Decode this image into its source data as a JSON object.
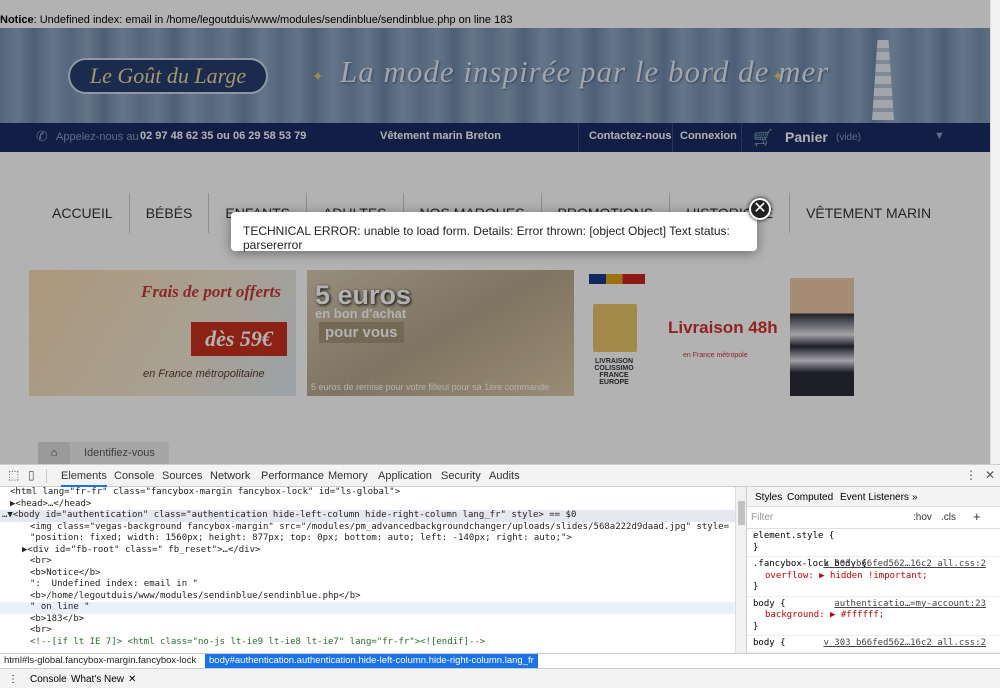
{
  "notice": {
    "label": "Notice",
    "text": ": Undefined index: email in /home/legoutduis/www/modules/sendinblue/sendinblue.php on line 183"
  },
  "header": {
    "logo": "Le Goût du Large",
    "tagline": "La mode inspirée par le bord de mer"
  },
  "topbar": {
    "call_label": "Appelez-nous au :",
    "phone": "02 97 48 62 35 ou 06 29 58 53 79",
    "middle": "Vêtement marin Breton",
    "contact": "Contactez-nous",
    "login": "Connexion",
    "cart": "Panier",
    "cart_state": "(vide)"
  },
  "menu": {
    "items": [
      "ACCUEIL",
      "BÉBÉS",
      "ENFANTS",
      "ADULTES",
      "NOS MARQUES",
      "PROMOTIONS",
      "HISTORIQUE",
      "VÊTEMENT MARIN"
    ]
  },
  "banners": {
    "b1": {
      "title": "Frais de port offerts",
      "badge": "dès 59€",
      "sub": "en France métropolitaine"
    },
    "b2": {
      "title": "5 euros",
      "line2": "en bon d'achat",
      "box": "pour vous",
      "sub": "5 euros de remise pour votre filleul pour sa 1ère commande"
    },
    "b3": {
      "title": "Livraison 48h",
      "sub": "en France métropole",
      "pack": "LIVRAISON COLISSIMO FRANCE EUROPE"
    }
  },
  "breadcrumb": {
    "current": "Identifiez-vous"
  },
  "modal": {
    "message": "TECHNICAL ERROR: unable to load form. Details: Error thrown: [object Object] Text status: parsererror",
    "close": "✕"
  },
  "devtools": {
    "tabs": [
      "Elements",
      "Console",
      "Sources",
      "Network",
      "Performance",
      "Memory",
      "Application",
      "Security",
      "Audits"
    ],
    "dom_lines": [
      "<html lang=\"fr-fr\" class=\"fancybox-margin fancybox-lock\" id=\"ls-global\">",
      "▶<head>…</head>",
      "…▼<body id=\"authentication\" class=\"authentication hide-left-column hide-right-column lang_fr\" style> == $0",
      "<img class=\"vegas-background fancybox-margin\" src=\"/modules/pm_advancedbackgroundchanger/uploads/slides/568a222d9daad.jpg\" style=",
      "\"position: fixed; width: 1560px; height: 877px; top: 0px; bottom: auto; left: -140px; right: auto;\">",
      "▶<div id=\"fb-root\" class=\" fb_reset\">…</div>",
      "<br>",
      "<b>Notice</b>",
      "\":  Undefined index: email in \"",
      "<b>/home/legoutduis/www/modules/sendinblue/sendinblue.php</b>",
      "\" on line \"",
      "<b>183</b>",
      "<br>",
      "<!--[if lt IE 7]> <html class=\"no-js lt-ie9 lt-ie8 lt-ie7\" lang=\"fr-fr\"><![endif]-->"
    ],
    "styles_tabs": [
      "Styles",
      "Computed",
      "Event Listeners"
    ],
    "filter_placeholder": "Filter",
    "hov": ":hov",
    "cls": ".cls",
    "rules": [
      {
        "selector": "element.style {",
        "props": [],
        "src": ""
      },
      {
        "selector": ".fancybox-lock body {",
        "props": [
          "overflow: ▶ hidden !important;"
        ],
        "src": "v_303_b66fed562…16c2_all.css:2"
      },
      {
        "selector": "body {",
        "props": [
          "background: ▶ #ffffff;"
        ],
        "src": "authenticatio…=my-account:23"
      },
      {
        "selector": "body {",
        "props": [],
        "src": "v_303_b66fed562…16c2_all.css:2"
      }
    ],
    "crumb_root": "html#ls-global.fancybox-margin.fancybox-lock",
    "crumb_body": "body#authentication.authentication.hide-left-column.hide-right-column.lang_fr",
    "drawer_tabs": [
      "Console",
      "What's New"
    ]
  }
}
